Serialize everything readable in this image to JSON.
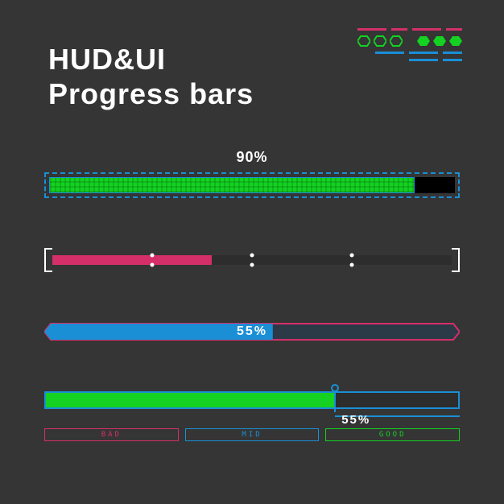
{
  "title_line1": "HUD&UI",
  "title_line2": "Progress bars",
  "colors": {
    "green": "#14d122",
    "blue": "#1a8fd6",
    "pink": "#d52f6a",
    "bg": "#353535"
  },
  "bar1": {
    "percent": 90,
    "label": "90%"
  },
  "bar2": {
    "percent": 40
  },
  "bar3": {
    "percent": 55,
    "label": "55%"
  },
  "bar4": {
    "percent": 70,
    "label": "55%",
    "scale": {
      "bad": "BAD",
      "mid": "MID",
      "good": "GOOD"
    }
  }
}
